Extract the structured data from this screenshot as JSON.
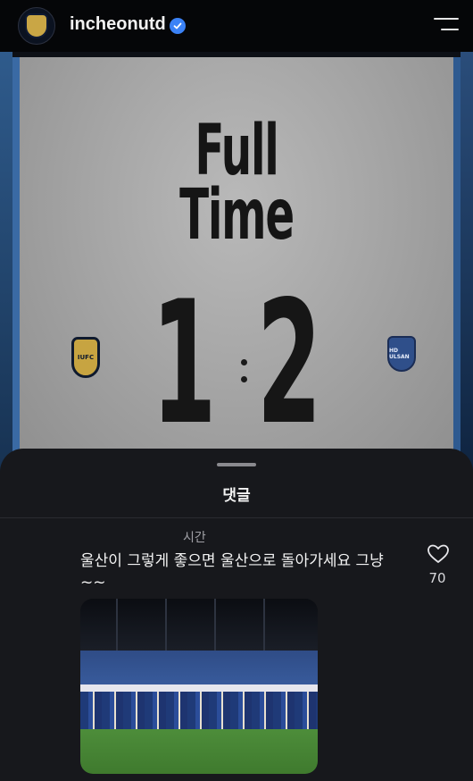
{
  "header": {
    "avatar_icon": "club-crest-avatar",
    "handle": "incheonutd",
    "verified_icon": "verified-badge-icon",
    "menu_icon": "menu-icon"
  },
  "post": {
    "headline_line1": "Full",
    "headline_line2": "Time",
    "home_score": "1",
    "separator": ":",
    "away_score": "2",
    "home_crest_text": "IUFC",
    "away_crest_text": "HD ULSAN"
  },
  "comments_sheet": {
    "title": "댓글",
    "comment": {
      "time": "시간",
      "text": "울산이 그렇게 좋으면 울산으로 돌아가세요 그냥~~",
      "like_icon": "heart-icon",
      "likes": "70",
      "attached_image": "team-photo-on-pitch"
    }
  },
  "colors": {
    "background": "#000000",
    "sheet": "#17181c",
    "verified": "#3b82f6",
    "board": "#a6a6a6"
  }
}
